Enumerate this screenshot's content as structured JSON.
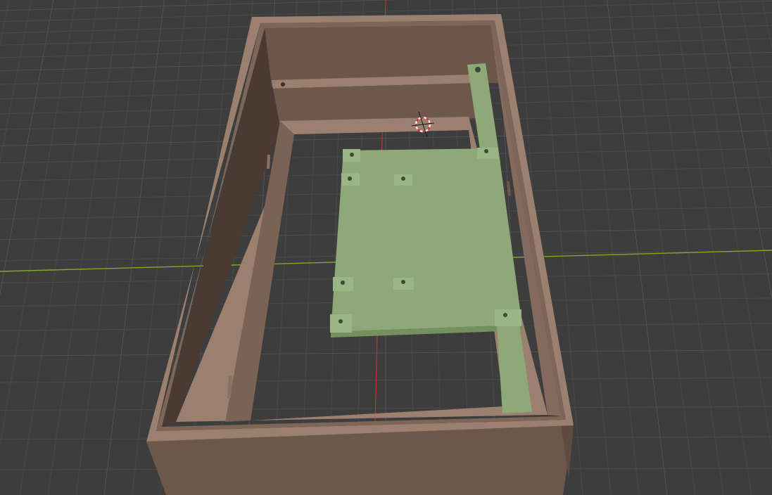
{
  "viewport": {
    "background_color": "#3d3d3d",
    "grid_minor_color": "#484848",
    "grid_major_color": "#525252",
    "x_axis_color": "#7fa826",
    "y_axis_color": "#c1323d"
  },
  "scene": {
    "enclosure": {
      "name": "enclosure-box",
      "top_color": "#9b806f",
      "outer_wall_color": "#6c574b",
      "inner_wall_dark": "#4b3a31",
      "inner_wall_mid": "#6b5649",
      "inner_wall_light": "#836a5c"
    },
    "mounting_plate": {
      "name": "mounting-plate",
      "top_color": "#8ea878",
      "side_color": "#74905f",
      "hole_color": "#3e4a35"
    },
    "cursor": {
      "name": "3d-cursor",
      "ring_red": "#e0342f",
      "ring_white": "#f2f2f2"
    }
  }
}
